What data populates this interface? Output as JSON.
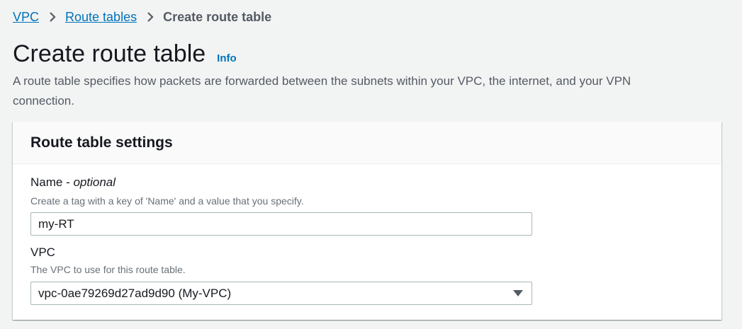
{
  "breadcrumb": {
    "items": [
      {
        "label": "VPC"
      },
      {
        "label": "Route tables"
      },
      {
        "label": "Create route table"
      }
    ]
  },
  "header": {
    "title": "Create route table",
    "info_label": "Info",
    "description": "A route table specifies how packets are forwarded between the subnets within your VPC, the internet, and your VPN connection."
  },
  "settings": {
    "title": "Route table settings",
    "name_field": {
      "label": "Name - ",
      "label_optional": "optional",
      "hint": "Create a tag with a key of 'Name' and a value that you specify.",
      "value": "my-RT"
    },
    "vpc_field": {
      "label": "VPC",
      "hint": "The VPC to use for this route table.",
      "selected": "vpc-0ae79269d27ad9d90 (My-VPC)"
    }
  },
  "icons": {
    "separator": "chevron-right-icon",
    "dropdown": "caret-down-icon"
  },
  "colors": {
    "link": "#0073bb",
    "background": "#f2f3f3",
    "text": "#16191f",
    "secondary_text": "#545b64"
  }
}
